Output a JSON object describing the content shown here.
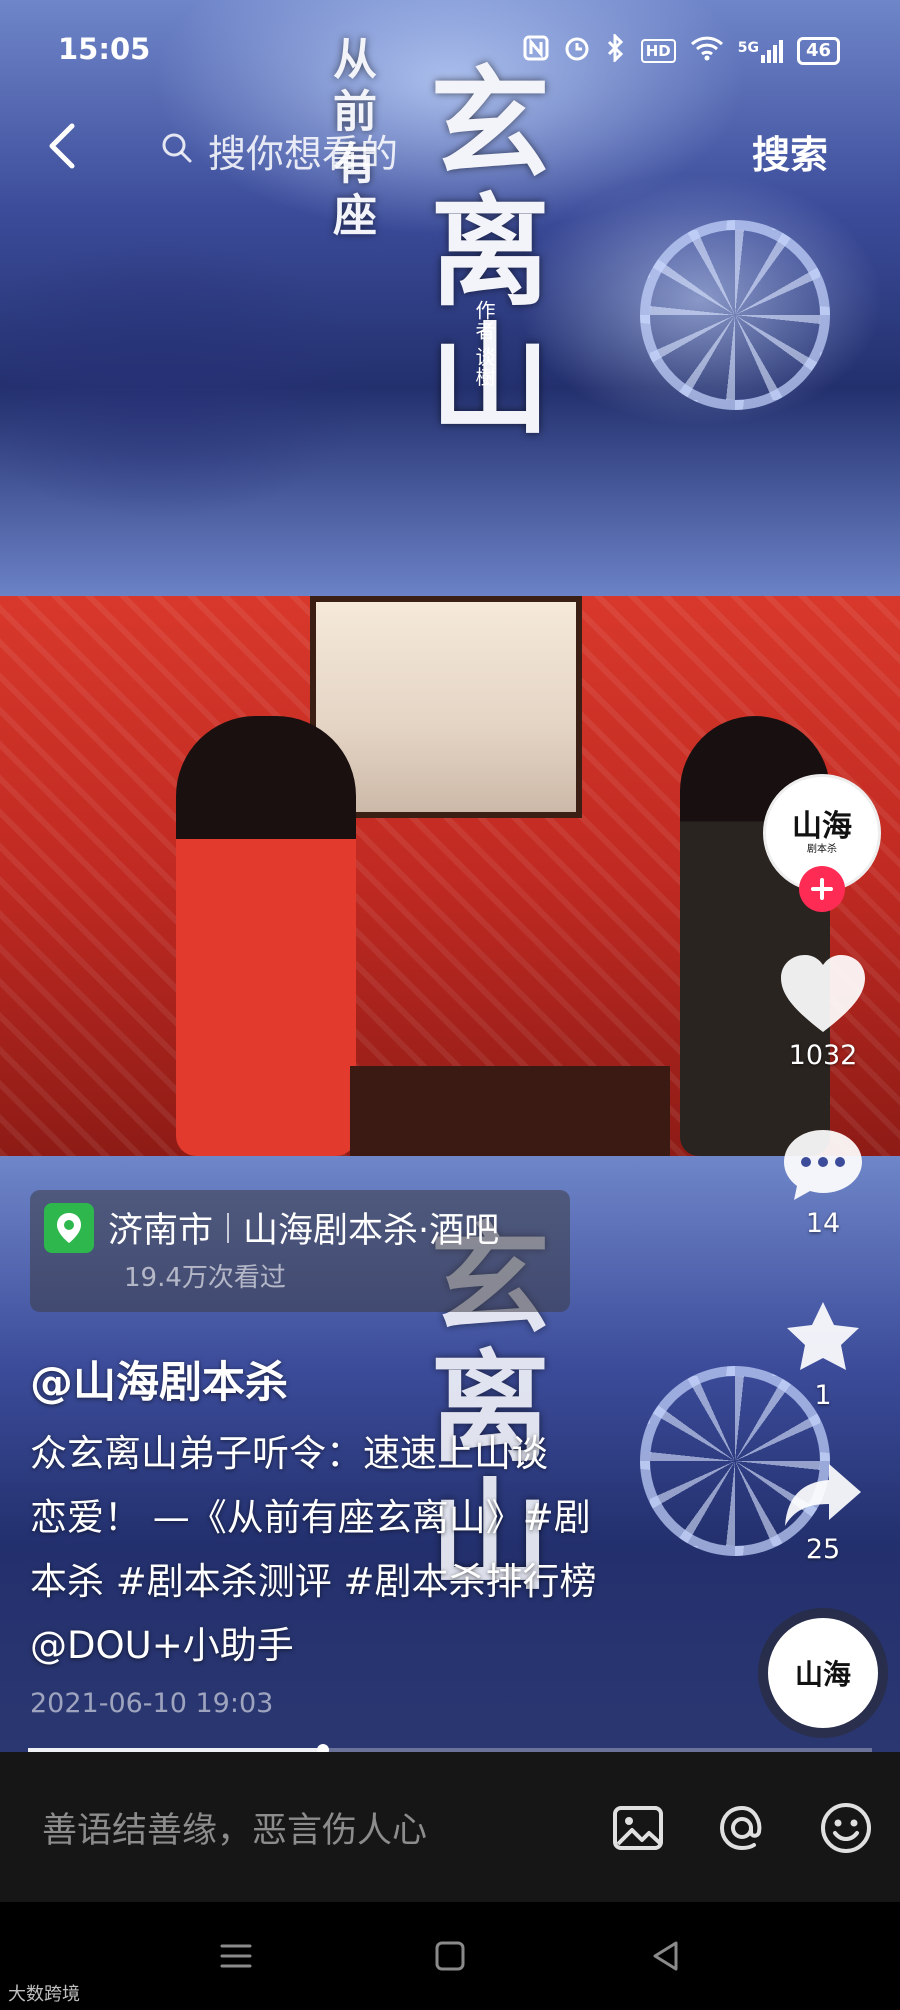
{
  "status_bar": {
    "time": "15:05",
    "icons": [
      "nfc-icon",
      "alarm-icon",
      "bluetooth-icon",
      "hd-icon",
      "wifi-icon",
      "5g-signal-icon"
    ],
    "hd_label": "HD",
    "network_label": "5G",
    "battery": "46"
  },
  "search": {
    "placeholder": "搜你想看的",
    "button_label": "搜索"
  },
  "video": {
    "poster_title": "玄离山",
    "poster_subtitle": "从前有座",
    "poster_author": "作者 谈樹"
  },
  "rail": {
    "avatar_text": "山海",
    "avatar_subtext": "剧本杀",
    "likes": "1032",
    "comments": "14",
    "favorites": "1",
    "shares": "25"
  },
  "caption": {
    "city": "济南市",
    "venue": "山海剧本杀·酒吧",
    "views": "19.4万次看过",
    "author": "@山海剧本杀",
    "description_lines": [
      "众玄离山弟子听令：速速上山谈",
      "恋爱！ —《从前有座玄离山》#剧",
      "本杀 #剧本杀测评 #剧本杀排行榜",
      "@DOU+小助手"
    ],
    "date": "2021-06-10 19:03"
  },
  "progress": {
    "fraction": 0.35
  },
  "comment_bar": {
    "placeholder": "善语结善缘，恶言伤人心"
  },
  "watermark": "大数跨境",
  "colors": {
    "accent": "#fe2c55",
    "location_pin": "#2db74c",
    "comment_bar_bg": "#161616"
  }
}
